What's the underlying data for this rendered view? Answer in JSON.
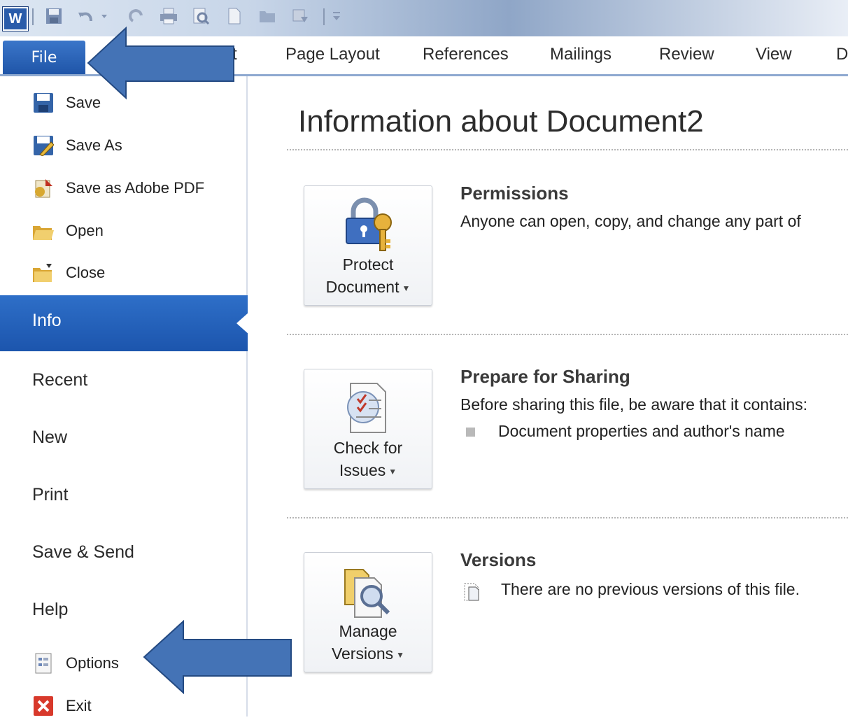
{
  "app": {
    "logo_letter": "W"
  },
  "quick_access": {
    "icons": [
      "save-icon",
      "undo-icon",
      "undo-dropdown-icon",
      "redo-icon",
      "print-icon",
      "print-preview-icon",
      "new-document-icon",
      "open-folder-icon",
      "more-icon",
      "customize-icon"
    ]
  },
  "ribbon": {
    "file_label": "File",
    "partial_tab": "t",
    "tabs": [
      "Page Layout",
      "References",
      "Mailings",
      "Review",
      "View",
      "D"
    ]
  },
  "backstage_nav": {
    "commands": [
      {
        "label": "Save",
        "icon": "save-icon"
      },
      {
        "label": "Save As",
        "icon": "save-as-icon"
      },
      {
        "label": "Save as Adobe PDF",
        "icon": "adobe-pdf-icon"
      },
      {
        "label": "Open",
        "icon": "open-folder-icon"
      },
      {
        "label": "Close",
        "icon": "close-folder-icon"
      }
    ],
    "active_tab": "Info",
    "tabs": [
      "Recent",
      "New",
      "Print",
      "Save & Send",
      "Help"
    ],
    "bottom_commands": [
      {
        "label": "Options",
        "icon": "options-icon"
      },
      {
        "label": "Exit",
        "icon": "exit-icon"
      }
    ]
  },
  "info": {
    "title": "Information about Document2",
    "sections": [
      {
        "button": {
          "line1": "Protect",
          "line2": "Document",
          "icon": "lock-key-icon"
        },
        "heading": "Permissions",
        "text": "Anyone can open, copy, and change any part of"
      },
      {
        "button": {
          "line1": "Check for",
          "line2": "Issues",
          "icon": "checklist-icon"
        },
        "heading": "Prepare for Sharing",
        "text": "Before sharing this file, be aware that it contains:",
        "bullet": "Document properties and author's name"
      },
      {
        "button": {
          "line1": "Manage",
          "line2": "Versions",
          "icon": "versions-magnifier-icon"
        },
        "heading": "Versions",
        "text": "There are no previous versions of this file."
      }
    ]
  },
  "colors": {
    "accent": "#1f55a8",
    "arrow": "#3f73b3"
  }
}
